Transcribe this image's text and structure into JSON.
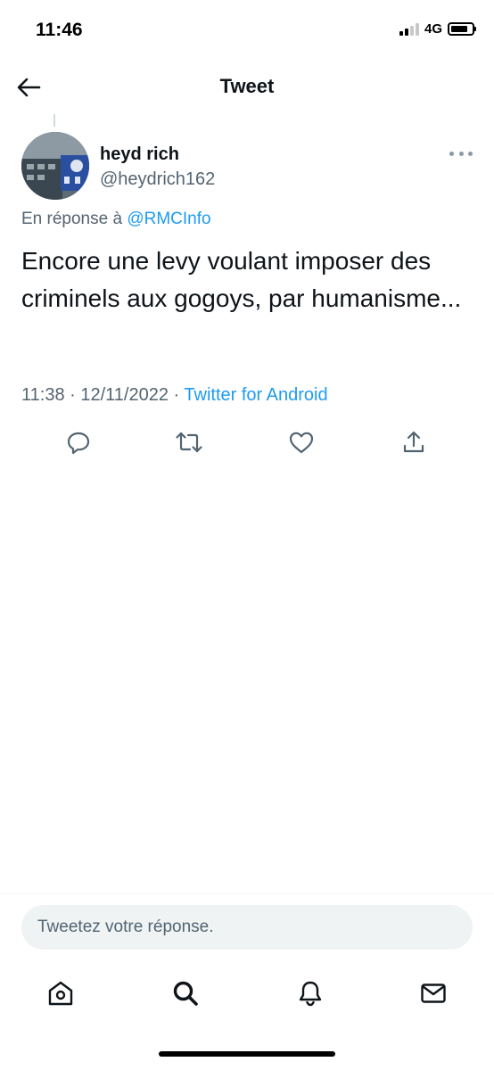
{
  "status_bar": {
    "time": "11:46",
    "network": "4G",
    "signal_bars": 2,
    "battery_level": 0.8
  },
  "header": {
    "title": "Tweet",
    "back_icon": "arrow-left-icon"
  },
  "tweet": {
    "author": {
      "name": "heyd rich",
      "handle": "@heydrich162"
    },
    "reply_to_prefix": "En réponse à ",
    "reply_to_handle": "@RMCInfo",
    "text": "Encore une levy voulant imposer des criminels aux gogoys, par humanisme...",
    "time": "11:38",
    "separator": " · ",
    "date": "12/11/2022",
    "source": "Twitter for Android",
    "actions": [
      "reply-icon",
      "retweet-icon",
      "like-icon",
      "share-icon"
    ]
  },
  "compose": {
    "placeholder": "Tweetez votre réponse."
  },
  "tab_bar": {
    "items": [
      "home-icon",
      "search-icon",
      "notifications-icon",
      "messages-icon"
    ]
  },
  "colors": {
    "accent": "#1d9bf0",
    "secondary_text": "#536471",
    "primary_text": "#0f1419"
  }
}
